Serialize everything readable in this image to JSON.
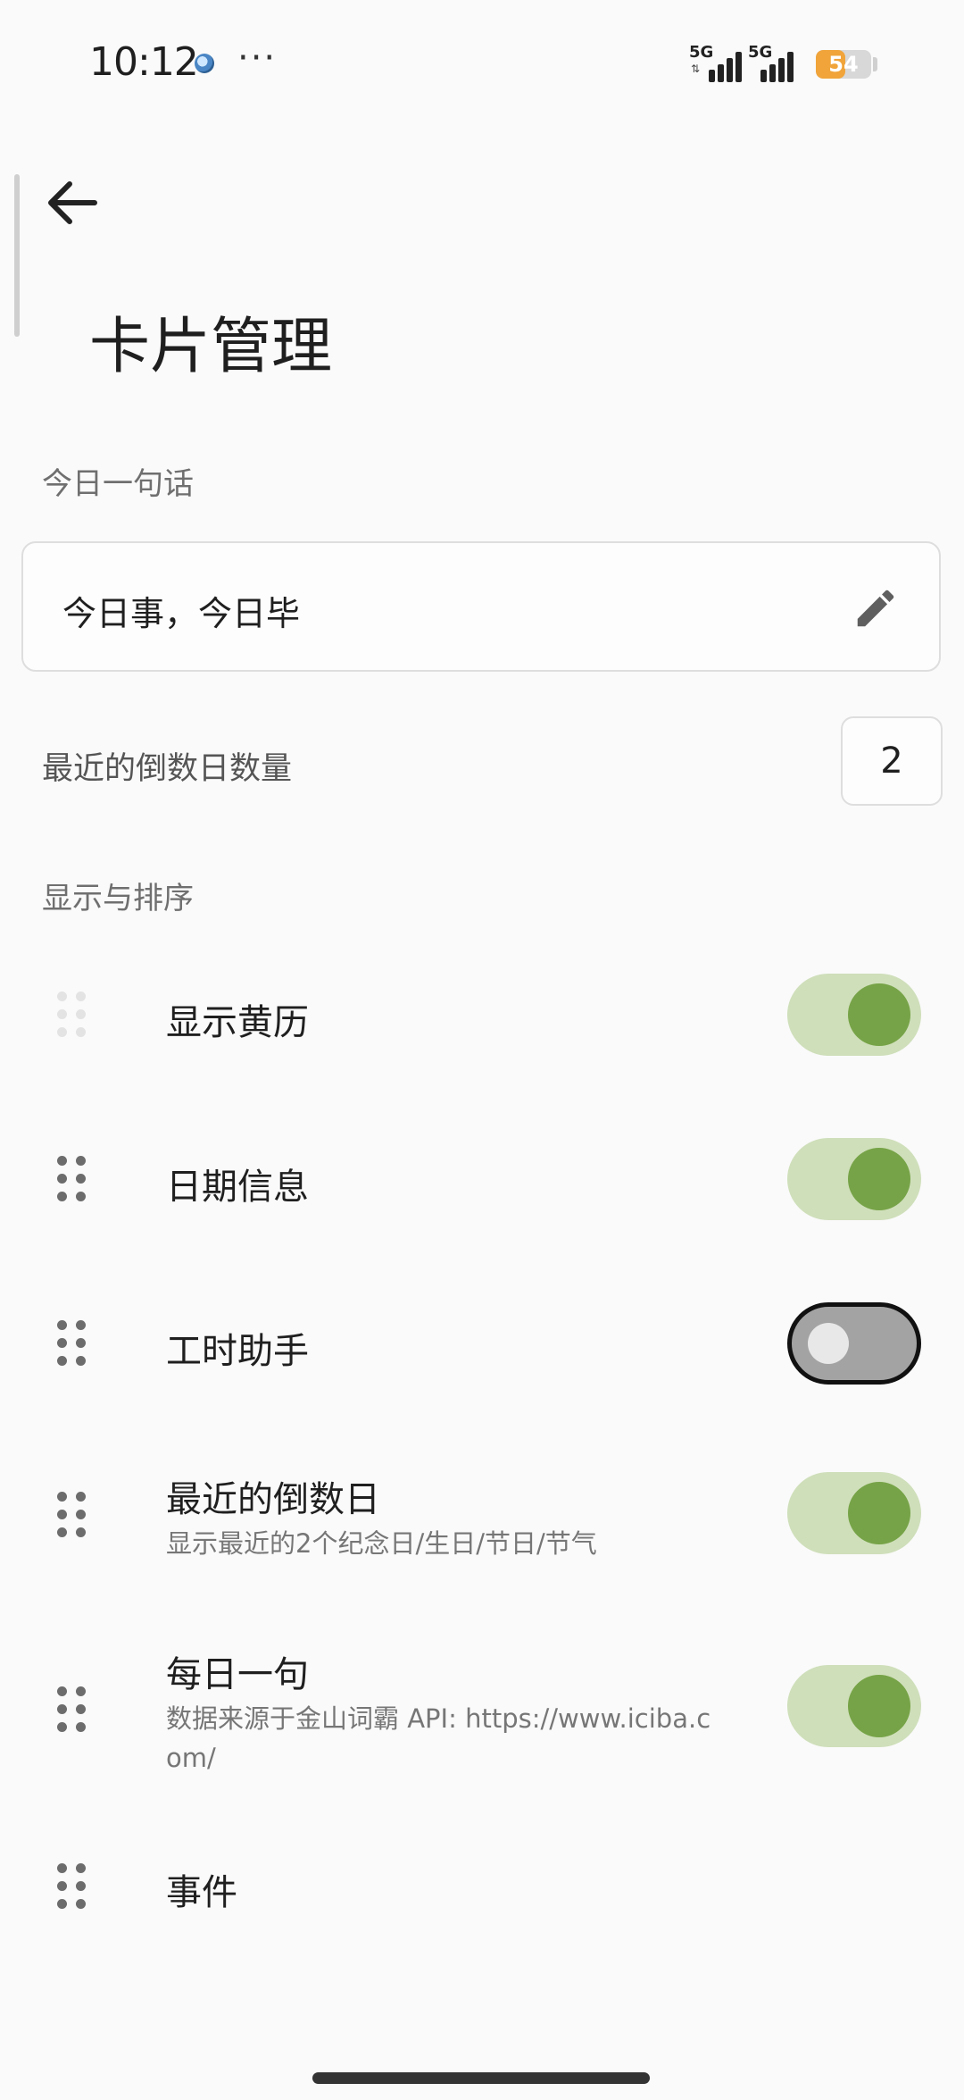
{
  "status_bar": {
    "time": "10:12",
    "more": "···",
    "signal_1": "5G",
    "signal_2": "5G",
    "battery": "54",
    "battery_percent": 54
  },
  "header": {
    "back_icon": "arrow-left-icon",
    "title": "卡片管理"
  },
  "quote_section": {
    "label": "今日一句话",
    "value": "今日事，今日毕",
    "edit_icon": "pencil-icon"
  },
  "countdown_count": {
    "label": "最近的倒数日数量",
    "value": "2"
  },
  "display_section": {
    "label": "显示与排序",
    "items": [
      {
        "title": "显示黄历",
        "subtitle": "",
        "toggle": "on",
        "handle": "faded"
      },
      {
        "title": "日期信息",
        "subtitle": "",
        "toggle": "on",
        "handle": "normal"
      },
      {
        "title": "工时助手",
        "subtitle": "",
        "toggle": "off",
        "handle": "normal"
      },
      {
        "title": "最近的倒数日",
        "subtitle": "显示最近的2个纪念日/生日/节日/节气",
        "toggle": "on",
        "handle": "normal"
      },
      {
        "title": "每日一句",
        "subtitle": "数据来源于金山词霸 API: https://www.iciba.com/",
        "toggle": "on",
        "handle": "normal"
      },
      {
        "title": "事件",
        "subtitle": "",
        "toggle": "none",
        "handle": "normal"
      }
    ]
  },
  "colors": {
    "accent": "#76a347",
    "toggle_track_on": "#cfdfba",
    "toggle_track_off": "#a3a3a3",
    "battery": "#f0a43a"
  }
}
